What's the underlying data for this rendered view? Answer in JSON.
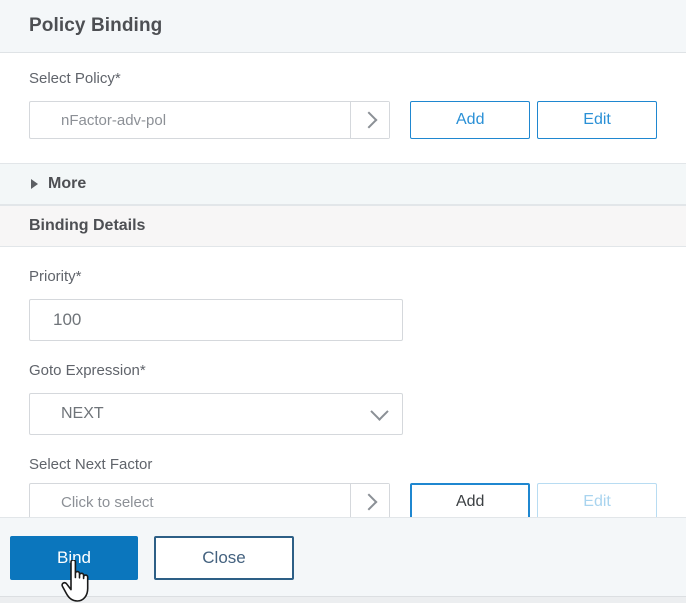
{
  "header": {
    "title": "Policy Binding"
  },
  "select_policy": {
    "label": "Select Policy*",
    "value": "nFactor-adv-pol",
    "picker_icon": "chevron-right-icon",
    "add_label": "Add",
    "edit_label": "Edit"
  },
  "more": {
    "label": "More",
    "expander_icon": "triangle-right-icon"
  },
  "binding_details": {
    "section_label": "Binding Details",
    "priority": {
      "label": "Priority*",
      "value": "100"
    },
    "goto_expression": {
      "label": "Goto Expression*",
      "value": "NEXT",
      "dropdown_icon": "chevron-down-icon"
    },
    "select_next_factor": {
      "label": "Select Next Factor",
      "placeholder": "Click to select",
      "picker_icon": "chevron-right-icon",
      "add_label": "Add",
      "edit_label": "Edit"
    }
  },
  "footer": {
    "bind_label": "Bind",
    "close_label": "Close"
  },
  "colors": {
    "primary": "#0b76bd",
    "link_blue": "#2a90d6",
    "border_blue": "#1f87d0",
    "secondary_border": "#2d5f86",
    "header_bg": "#f4f7f9",
    "band_more_bg": "#f3f7f8",
    "band_details_bg": "#f7f6f6",
    "field_border": "#d5d8dc",
    "label_text": "#60646b",
    "disabled_blue": "#a9d4ef"
  },
  "cursor": {
    "icon": "pointing-hand-cursor"
  }
}
